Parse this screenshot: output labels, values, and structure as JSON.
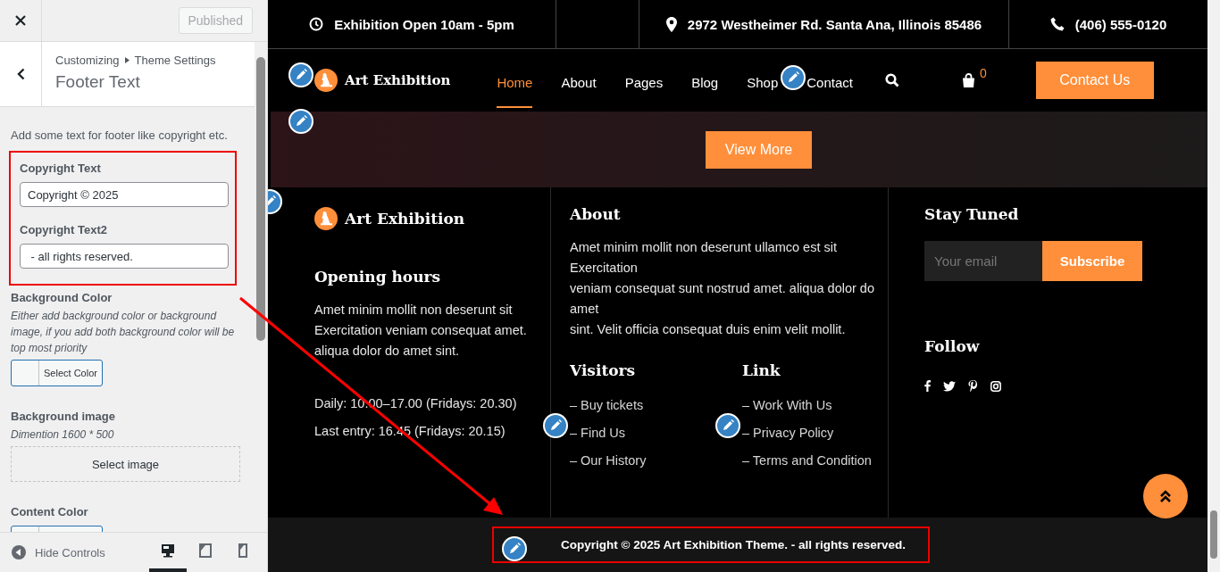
{
  "customizer": {
    "publish_button": {
      "label": "Published",
      "disabled": true
    },
    "breadcrumb": {
      "parent": "Customizing",
      "section": "Theme Settings"
    },
    "panel_title": "Footer Text",
    "description": "Add some text for footer like copyright etc.",
    "fields": [
      {
        "kind": "text",
        "label": "Copyright Text",
        "value": "Copyright © 2025",
        "highlighted": true
      },
      {
        "kind": "text",
        "label": "Copyright Text2",
        "value": " - all rights reserved.",
        "highlighted": true
      },
      {
        "kind": "color",
        "label": "Background Color",
        "description": "Either add background color or background image, if you add both background color will be top most priority",
        "button": "Select Color",
        "highlighted": false
      },
      {
        "kind": "image",
        "label": "Background image",
        "description": "Dimention 1600 * 500",
        "button": "Select image",
        "highlighted": false
      },
      {
        "kind": "color",
        "label": "Content Color",
        "highlighted": false
      }
    ],
    "hide_controls": "Hide Controls",
    "devices": [
      {
        "kind": "desktop",
        "selected": true
      },
      {
        "kind": "tablet",
        "selected": false
      },
      {
        "kind": "mobile",
        "selected": false
      }
    ]
  },
  "site": {
    "topbar": [
      {
        "kind": "clock",
        "text": "Exhibition Open 10am - 5pm"
      },
      {
        "kind": "pin",
        "text": "2972 Westheimer Rd. Santa Ana, Illinois 85486"
      },
      {
        "kind": "phone",
        "text": "(406) 555-0120"
      }
    ],
    "header": {
      "logo": "Art Exhibition",
      "nav": [
        {
          "label": "Home",
          "selected": true
        },
        {
          "label": "About",
          "selected": false
        },
        {
          "label": "Pages",
          "selected": false
        },
        {
          "label": "Blog",
          "selected": false
        },
        {
          "label": "Shop",
          "selected": false
        },
        {
          "label": "Contact",
          "selected": false
        }
      ],
      "cart_count": "0",
      "cta": "Contact Us"
    },
    "hero": {
      "button": "View More"
    },
    "footer": {
      "logo": "Art Exhibition",
      "hours_title": "Opening hours",
      "hours_text": "Amet minim mollit non deserunt sit Exercitation veniam consequat amet. aliqua dolor do amet sint.",
      "hours": [
        "Daily: 10.00–17.00 (Fridays: 20.30)",
        "Last entry: 16.45 (Fridays: 20.15)"
      ],
      "about_title": "About",
      "about_lines": [
        "Amet minim mollit non deserunt ullamco est sit Exercitation",
        "veniam consequat sunt nostrud amet. aliqua dolor do amet",
        "sint. Velit officia consequat duis enim velit mollit."
      ],
      "link_groups": [
        {
          "title": "Visitors",
          "links": [
            "– Buy tickets",
            "– Find Us",
            "– Our History"
          ]
        },
        {
          "title": "Link",
          "links": [
            "– Work With Us",
            "– Privacy Policy",
            "– Terms and Condition"
          ]
        }
      ],
      "newsletter": {
        "title": "Stay Tuned",
        "placeholder": "Your email",
        "button": "Subscribe"
      },
      "follow_title": "Follow",
      "social": [
        {
          "kind": "facebook"
        },
        {
          "kind": "twitter"
        },
        {
          "kind": "pinterest"
        },
        {
          "kind": "instagram"
        }
      ]
    },
    "copyright": {
      "text": "Copyright © 2025 Art Exhibition Theme. - all rights reserved.",
      "highlighted": true
    }
  }
}
